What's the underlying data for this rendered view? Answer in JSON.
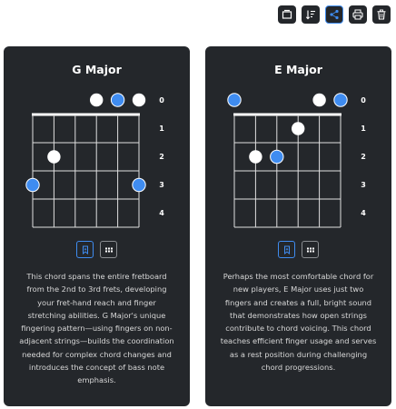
{
  "colors": {
    "card_bg": "#24272b",
    "accent": "#3f8cf0",
    "text": "#d8d8d8",
    "open_string": "#ffffff"
  },
  "toolbar": {
    "buttons": [
      {
        "icon": "window-icon",
        "active": false
      },
      {
        "icon": "sort-icon",
        "active": false
      },
      {
        "icon": "share-icon",
        "active": true
      },
      {
        "icon": "print-icon",
        "active": false
      },
      {
        "icon": "trash-icon",
        "active": false
      }
    ]
  },
  "cards": [
    {
      "title": "G Major",
      "fret_labels": [
        "0",
        "1",
        "2",
        "3",
        "4"
      ],
      "dots": [
        {
          "string": 3,
          "fret": 0,
          "color": "white"
        },
        {
          "string": 4,
          "fret": 0,
          "color": "blue"
        },
        {
          "string": 5,
          "fret": 0,
          "color": "white"
        },
        {
          "string": 1,
          "fret": 2,
          "color": "white"
        },
        {
          "string": 0,
          "fret": 3,
          "color": "blue"
        },
        {
          "string": 5,
          "fret": 3,
          "color": "blue"
        }
      ],
      "buttons": [
        {
          "icon": "bookmark-icon",
          "active": true
        },
        {
          "icon": "grid-icon",
          "active": false
        }
      ],
      "description": "This chord spans the entire fretboard from the 2nd to 3rd frets, developing your fret-hand reach and finger stretching abilities. G Major's unique fingering pattern—using fingers on non-adjacent strings—builds the coordination needed for complex chord changes and introduces the concept of bass note emphasis."
    },
    {
      "title": "E Major",
      "fret_labels": [
        "0",
        "1",
        "2",
        "3",
        "4"
      ],
      "dots": [
        {
          "string": 0,
          "fret": 0,
          "color": "blue"
        },
        {
          "string": 4,
          "fret": 0,
          "color": "white"
        },
        {
          "string": 5,
          "fret": 0,
          "color": "blue"
        },
        {
          "string": 3,
          "fret": 1,
          "color": "white"
        },
        {
          "string": 1,
          "fret": 2,
          "color": "white"
        },
        {
          "string": 2,
          "fret": 2,
          "color": "blue"
        }
      ],
      "buttons": [
        {
          "icon": "bookmark-icon",
          "active": true
        },
        {
          "icon": "grid-icon",
          "active": false
        }
      ],
      "description": "Perhaps the most comfortable chord for new players, E Major uses just two fingers and creates a full, bright sound that demonstrates how open strings contribute to chord voicing. This chord teaches efficient finger usage and serves as a rest position during challenging chord progressions."
    }
  ]
}
